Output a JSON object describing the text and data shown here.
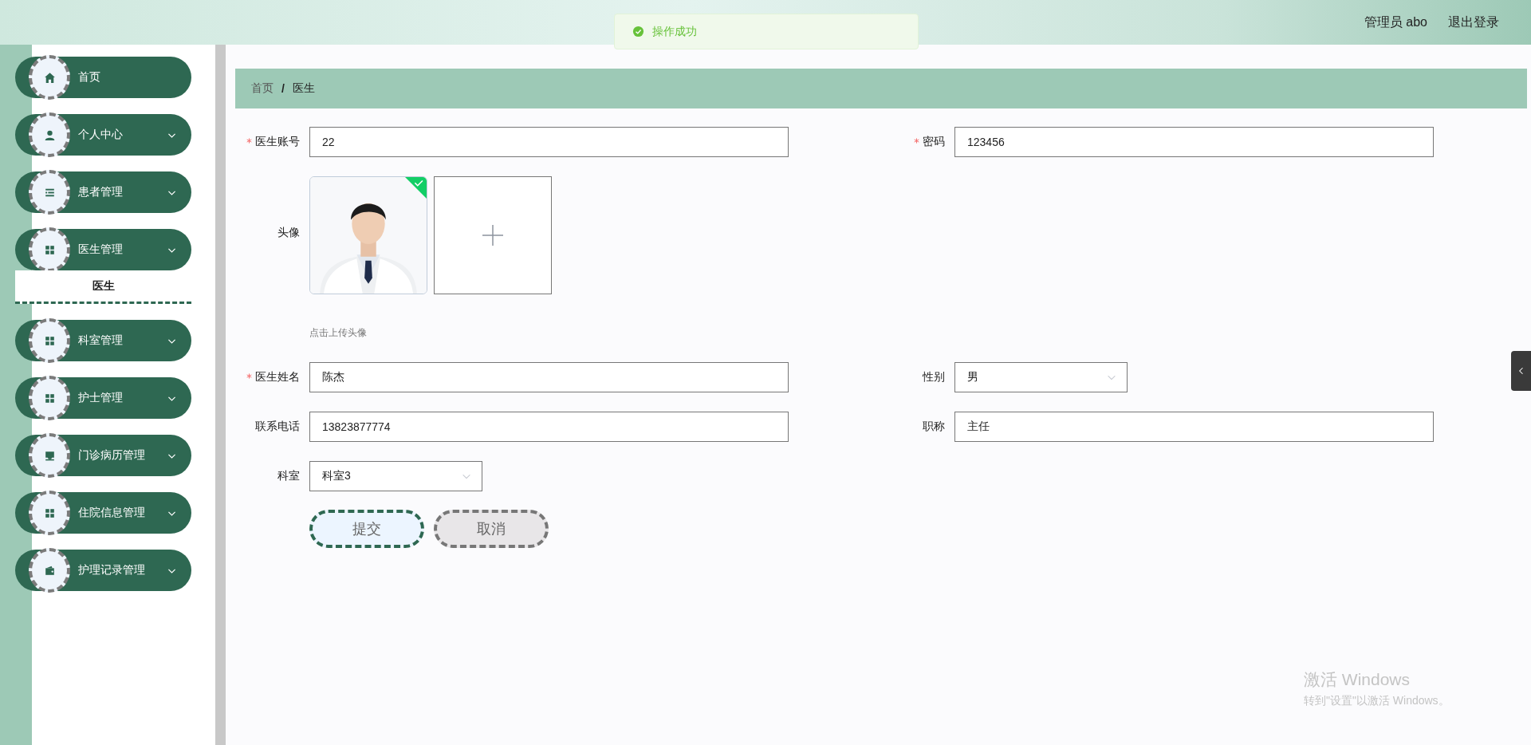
{
  "header": {
    "user": "管理员 abo",
    "logout": "退出登录"
  },
  "toast": {
    "kind": "success",
    "message": "操作成功"
  },
  "sidebar": {
    "items": [
      {
        "label": "首页",
        "kind": "home",
        "expandable": false,
        "expanded": false
      },
      {
        "label": "个人中心",
        "kind": "user",
        "expandable": true,
        "expanded": false
      },
      {
        "label": "患者管理",
        "kind": "list",
        "expandable": true,
        "expanded": false
      },
      {
        "label": "医生管理",
        "kind": "grid",
        "expandable": true,
        "expanded": true,
        "children": [
          {
            "label": "医生",
            "selected": true
          }
        ]
      },
      {
        "label": "科室管理",
        "kind": "grid",
        "expandable": true,
        "expanded": false
      },
      {
        "label": "护士管理",
        "kind": "grid",
        "expandable": true,
        "expanded": false
      },
      {
        "label": "门诊病历管理",
        "kind": "tray",
        "expandable": true,
        "expanded": false
      },
      {
        "label": "住院信息管理",
        "kind": "grid",
        "expandable": true,
        "expanded": false
      },
      {
        "label": "护理记录管理",
        "kind": "wallet",
        "expandable": true,
        "expanded": false
      }
    ]
  },
  "breadcrumb": {
    "separator": "/",
    "items": [
      {
        "label": "首页",
        "current": false
      },
      {
        "label": "医生",
        "current": true
      }
    ]
  },
  "form": {
    "rows": [
      [
        {
          "label": "医生账号",
          "required": true,
          "kind": "text",
          "value": "22"
        },
        {
          "label": "密码",
          "required": true,
          "kind": "text",
          "value": "123456"
        }
      ],
      [
        {
          "label": "头像",
          "required": false,
          "kind": "upload",
          "uploaded": true,
          "hint": "点击上传头像"
        }
      ],
      [
        {
          "label": "医生姓名",
          "required": true,
          "kind": "text",
          "value": "陈杰"
        },
        {
          "label": "性别",
          "required": false,
          "kind": "select",
          "value": "男"
        }
      ],
      [
        {
          "label": "联系电话",
          "required": false,
          "kind": "text",
          "value": "13823877774"
        },
        {
          "label": "职称",
          "required": false,
          "kind": "text",
          "value": "主任"
        }
      ],
      [
        {
          "label": "科室",
          "required": false,
          "kind": "select",
          "value": "科室3"
        }
      ]
    ],
    "buttons": [
      {
        "label": "提交",
        "kind": "primary"
      },
      {
        "label": "取消",
        "kind": "cancel"
      }
    ]
  },
  "os_overlay": {
    "title": "激活 Windows",
    "subtitle": "转到\"设置\"以激活 Windows。"
  }
}
